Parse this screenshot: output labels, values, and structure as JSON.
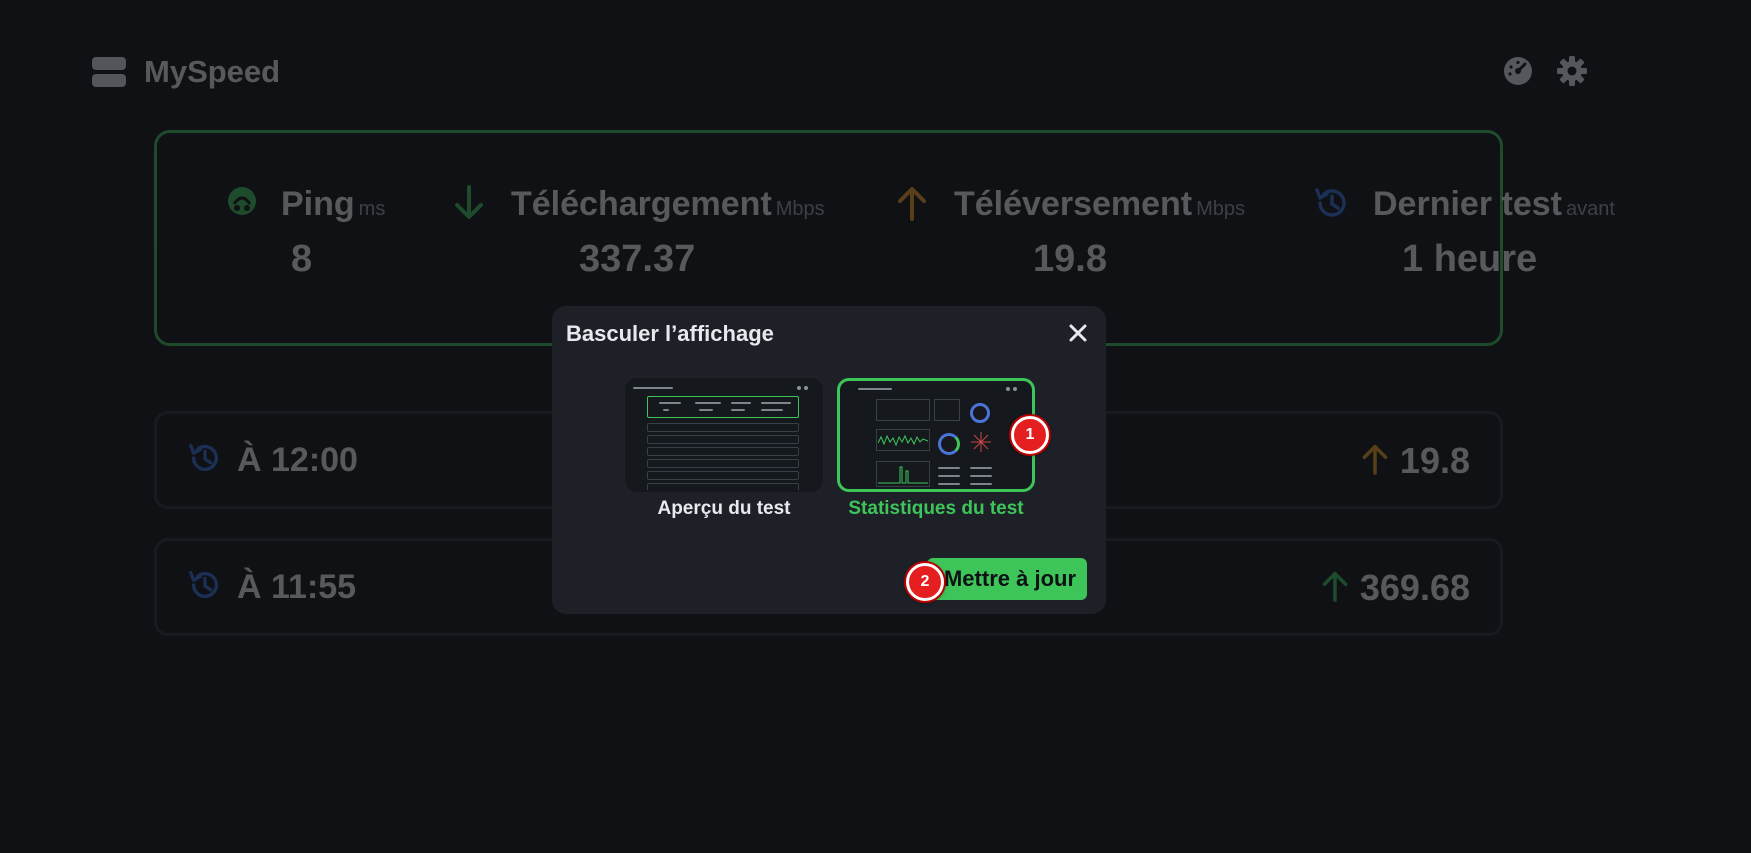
{
  "app": {
    "title": "MySpeed"
  },
  "stats": [
    {
      "label": "Ping",
      "unit": "ms",
      "value": "8",
      "icon": "ping-icon",
      "color": "#3dc55a"
    },
    {
      "label": "Téléchargement",
      "unit": "Mbps",
      "value": "337.37",
      "icon": "download-arrow-icon",
      "color": "#3dc55a"
    },
    {
      "label": "Téléversement",
      "unit": "Mbps",
      "value": "19.8",
      "icon": "upload-arrow-icon",
      "color": "#f0a020"
    },
    {
      "label": "Dernier test",
      "unit": "avant",
      "value": "1 heure",
      "icon": "history-icon",
      "color": "#3a6fd8"
    }
  ],
  "tests": [
    {
      "time": "À 12:00",
      "speed": "19.8",
      "arrow_color": "#f0a020"
    },
    {
      "time": "À 11:55",
      "speed": "369.68",
      "arrow_color": "#3dc55a"
    }
  ],
  "modal": {
    "title": "Basculer l’affichage",
    "options": [
      {
        "label": "Aperçu du test",
        "selected": false
      },
      {
        "label": "Statistiques du test",
        "selected": true
      }
    ],
    "update_label": "Mettre à jour"
  },
  "markers": [
    "1",
    "2"
  ],
  "colors": {
    "accent": "#3dc55a",
    "background": "#0f1115",
    "modal": "#1d2026",
    "marker": "#e51f1f"
  }
}
